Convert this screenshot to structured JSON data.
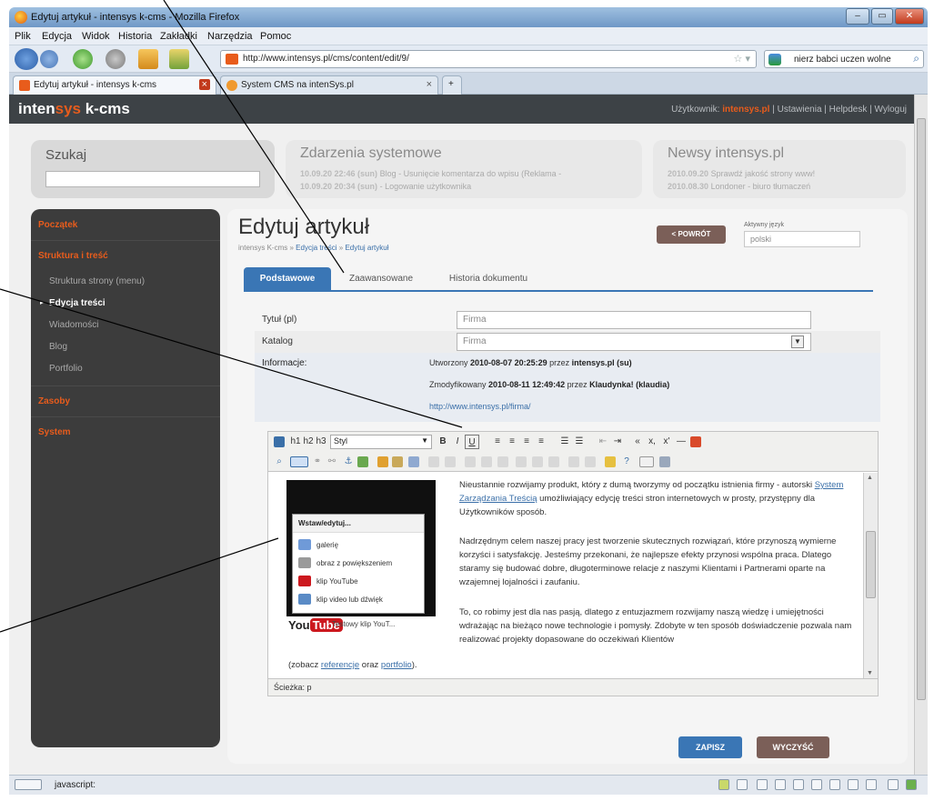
{
  "browser": {
    "window_title": "Edytuj artykuł - intensys k-cms - Mozilla Firefox",
    "menu": [
      "Plik",
      "Edycja",
      "Widok",
      "Historia",
      "Zakładki",
      "Narzędzia",
      "Pomoc"
    ],
    "url": "http://www.intensys.pl/cms/content/edit/9/",
    "search_value": "nierz babci uczen wolne",
    "tabs": [
      {
        "label": "Edytuj artykuł - intensys k-cms",
        "active": true
      },
      {
        "label": "System CMS na intenSys.pl",
        "active": false
      }
    ],
    "new_tab": "+",
    "tab_close": "×",
    "status_text": "javascript:"
  },
  "cms": {
    "logo_a": "inten",
    "logo_b": "sys",
    "logo_c": " k-cms",
    "user_label": "Użytkownik:",
    "user_name": "intensys.pl",
    "user_links": "| Ustawienia | Helpdesk | Wyloguj"
  },
  "search_panel": {
    "label": "Szukaj"
  },
  "events": {
    "title": "Zdarzenia systemowe",
    "items": [
      {
        "date": "10.09.20 22:46 (sun)",
        "text": "Blog - Usunięcie komentarza do wpisu (Reklama -"
      },
      {
        "date": "10.09.20 20:34 (sun)",
        "text": "- Logowanie użytkownika"
      }
    ]
  },
  "news": {
    "title": "Newsy intensys.pl",
    "items": [
      {
        "date": "2010.09.20",
        "text": "Sprawdź jakość strony www!"
      },
      {
        "date": "2010.08.30",
        "text": "Londoner - biuro tłumaczeń"
      }
    ]
  },
  "sidebar": {
    "items": [
      {
        "label": "Początek",
        "kind": "head"
      },
      {
        "label": "Struktura i treść",
        "kind": "head"
      },
      {
        "label": "Struktura strony (menu)",
        "kind": "sub"
      },
      {
        "label": "Edycja treści",
        "kind": "sel"
      },
      {
        "label": "Wiadomości",
        "kind": "sub"
      },
      {
        "label": "Blog",
        "kind": "sub"
      },
      {
        "label": "Portfolio",
        "kind": "sub"
      },
      {
        "label": "Zasoby",
        "kind": "head"
      },
      {
        "label": "System",
        "kind": "head"
      }
    ]
  },
  "content": {
    "title": "Edytuj artykuł",
    "breadcrumb": [
      "intensys K-cms",
      "Edycja treści",
      "Edytuj artykuł"
    ],
    "breadcrumb_sep": "»",
    "back_button": "< POWRÓT",
    "lang_label": "Aktywny język",
    "lang_value": "polski",
    "tabs": [
      "Podstawowe",
      "Zaawansowane",
      "Historia dokumentu"
    ],
    "fields": {
      "title_label": "Tytuł (pl)",
      "title_value": "Firma",
      "catalog_label": "Katalog",
      "catalog_value": "Firma",
      "info_label": "Informacje:"
    },
    "info": {
      "created_prefix": "Utworzony",
      "created_date": "2010-08-07 20:25:29",
      "created_by_prefix": "przez",
      "created_by": "intensys.pl (su)",
      "modified_prefix": "Zmodyfikowany",
      "modified_date": "2010-08-11 12:49:42",
      "modified_by_prefix": "przez",
      "modified_by": "Klaudynka! (klaudia)",
      "link": "http://www.intensys.pl/firma/"
    },
    "save_button": "ZAPISZ",
    "clear_button": "WYCZYŚĆ"
  },
  "editor": {
    "heading_buttons": [
      "h1",
      "h2",
      "h3"
    ],
    "style_select": "Styl",
    "format_buttons": [
      "B",
      "I",
      "U"
    ],
    "symbol_buttons": [
      "«",
      "x,",
      "x'",
      "—"
    ],
    "dropdown_title": "Wstaw/edytuj...",
    "dropdown_items": [
      {
        "label": "galerię",
        "color": "#6f9ad8"
      },
      {
        "label": "obraz z powiększeniem",
        "color": "#9a9a9a"
      },
      {
        "label": "klip YouTube",
        "color": "#cc181e"
      },
      {
        "label": "klip video lub dźwięk",
        "color": "#5a8bc6"
      }
    ],
    "youtube_logo_a": "You",
    "youtube_logo_b": "Tube",
    "video_title": "Testowy klip YouT...",
    "p1_a": "Nieustannie rozwijamy produkt, który z dumą tworzymy od początku istnienia firmy - autorski ",
    "p1_link": "System Zarządzania Treścią",
    "p1_b": " umożliwiający edycję treści stron internetowych w prosty, przystępny dla Użytkowników sposób.",
    "p2": "Nadrzędnym celem naszej pracy jest tworzenie skutecznych rozwiązań, które przynoszą wymierne korzyści i satysfakcję. Jesteśmy przekonani, że najlepsze efekty przynosi wspólna praca. Dlatego staramy się budować dobre, długoterminowe relacje z naszymi Klientami i Partnerami oparte na wzajemnej lojalności i zaufaniu.",
    "p3": "To, co robimy jest dla nas pasją, dlatego z entuzjazmem rozwijamy naszą wiedzę i umiejętności wdrażając na bieżąco nowe technologie i pomysły. Zdobyte w ten sposób doświadczenie pozwala nam realizować projekty dopasowane do oczekiwań Klientów",
    "p4_a": "(zobacz ",
    "p4_link1": "referencje",
    "p4_mid": " oraz ",
    "p4_link2": "portfolio",
    "p4_b": ").",
    "status": "Ścieżka: p"
  },
  "colors": {
    "accent": "#e85c1c",
    "tab_blue": "#3a76b5",
    "button_brown": "#7b5f58",
    "sidebar_bg": "#3c3c3c"
  }
}
